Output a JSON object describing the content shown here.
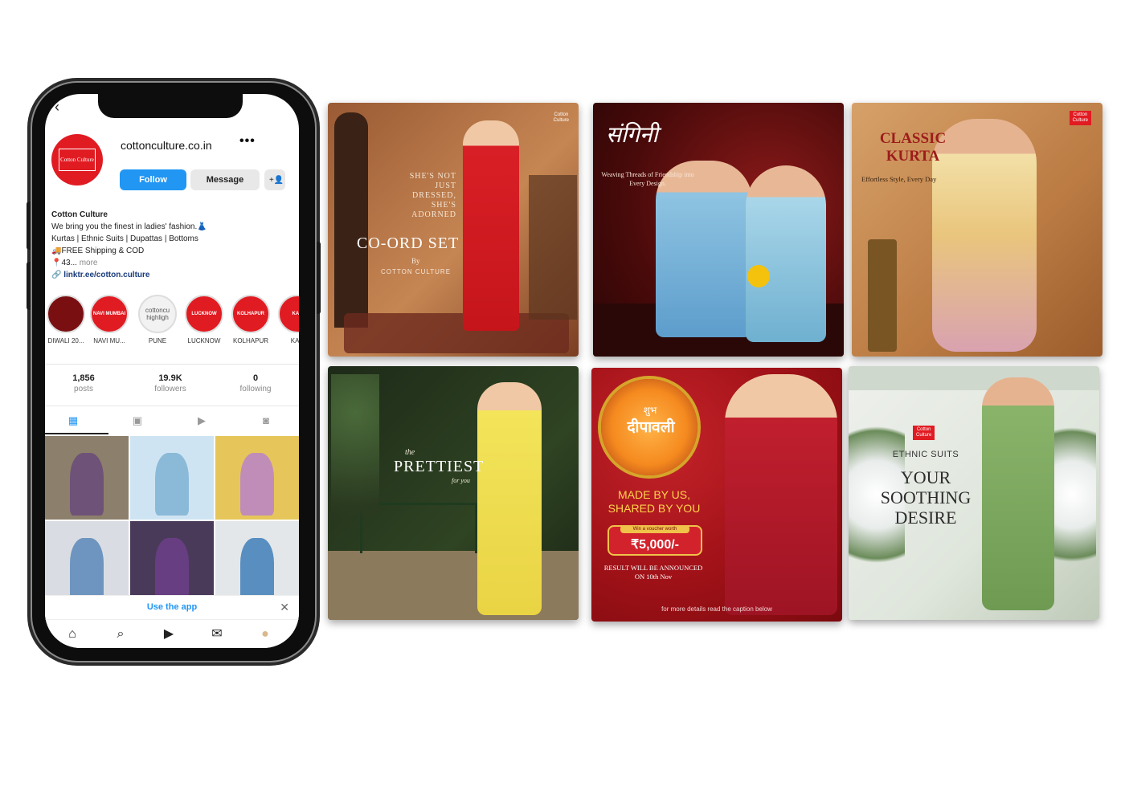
{
  "profile": {
    "username": "cottonculture.co.in",
    "logo_text": "Cotton Culture",
    "follow_label": "Follow",
    "message_label": "Message",
    "bio_name": "Cotton Culture",
    "bio_line1": "We bring you the finest in ladies' fashion.👗",
    "bio_line2": "Kurtas | Ethnic Suits | Dupattas | Bottoms",
    "bio_line3": "🚚FREE Shipping & COD",
    "bio_line4": "📍43...",
    "bio_more": "more",
    "bio_link": "linktr.ee/cotton.culture"
  },
  "highlights": [
    {
      "label": "DIWALI 20...",
      "inner": ""
    },
    {
      "label": "NAVI MU...",
      "inner": "NAVI MUMBAI"
    },
    {
      "label": "PUNE",
      "inner": "cottoncu highligh"
    },
    {
      "label": "LUCKNOW",
      "inner": "LUCKNOW"
    },
    {
      "label": "KOLHAPUR",
      "inner": "KOLHAPUR"
    },
    {
      "label": "KAN",
      "inner": "KAN"
    }
  ],
  "stats": {
    "posts_num": "1,856",
    "posts_label": "posts",
    "followers_num": "19.9K",
    "followers_label": "followers",
    "following_num": "0",
    "following_label": "following"
  },
  "use_app": "Use the app",
  "grid_colors": [
    "#6a4a7a",
    "#7fb3d5",
    "#b983c9",
    "#5b88b8",
    "#6c3f8a",
    "#3f7fb8"
  ],
  "posts": {
    "p1": {
      "tag": "SHE'S NOT JUST DRESSED, SHE'S ADORNED",
      "title": "CO-ORD SET",
      "by": "By",
      "brand": "COTTON CULTURE"
    },
    "p2": {
      "title": "संगिनी",
      "tagline": "Weaving Threads of Friendship into Every Design."
    },
    "p3": {
      "title": "CLASSIC KURTA",
      "tagline": "Effortless Style, Every Day"
    },
    "p4": {
      "title_the": "the",
      "title": "PRETTIEST",
      "title_for": "for you"
    },
    "p5": {
      "badge_top": "शुभ",
      "badge_main": "दीपावली",
      "headline1": "MADE BY US,",
      "headline2": "SHARED BY YOU",
      "voucher_label": "Win a voucher worth",
      "voucher_value": "₹5,000/-",
      "result1": "RESULT WILL BE ANNOUNCED",
      "result2": "ON 10th Nov",
      "footer": "for more details read the caption below"
    },
    "p6": {
      "label": "ETHNIC SUITS",
      "line1": "YOUR",
      "line2": "SOOTHING",
      "line3": "DESIRE"
    }
  },
  "colors": {
    "accent": "#2196f3",
    "brand_red": "#e11b22"
  }
}
